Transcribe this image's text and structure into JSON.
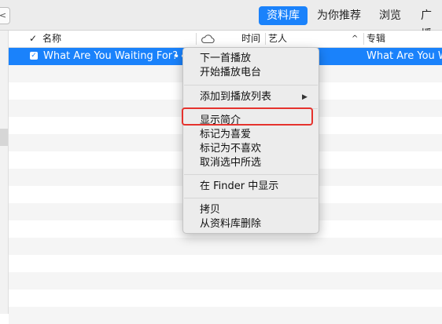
{
  "toolbar": {
    "back_glyph": "<",
    "tabs": [
      {
        "label": "资料库",
        "active": true
      },
      {
        "label": "为你推荐",
        "active": false
      },
      {
        "label": "浏览",
        "active": false
      },
      {
        "label": "广播",
        "active": false
      }
    ],
    "accent_color": "#1a82fb"
  },
  "table": {
    "headers": {
      "check": "✓",
      "name": "名称",
      "cloud_icon": "cloud-icon",
      "time": "时间",
      "artist": "艺人",
      "sort_indicator": "^",
      "album": "专辑"
    },
    "selected_row": {
      "checked": true,
      "title": "What Are You Waiting For?",
      "more": "•••",
      "album": "What Are You W"
    }
  },
  "context_menu": {
    "items": [
      {
        "label": "下一首播放"
      },
      {
        "label": "开始播放电台"
      },
      {
        "label": "添加到播放列表",
        "submenu_glyph": "▶"
      },
      {
        "label": "显示简介",
        "highlighted_by_red_box": true
      },
      {
        "label": "标记为喜爱"
      },
      {
        "label": "标记为不喜欢"
      },
      {
        "label": "取消选中所选"
      },
      {
        "label": "在 Finder 中显示"
      },
      {
        "label": "拷贝"
      },
      {
        "label": "从资料库删除"
      }
    ],
    "annotation_color": "#e5322d"
  }
}
